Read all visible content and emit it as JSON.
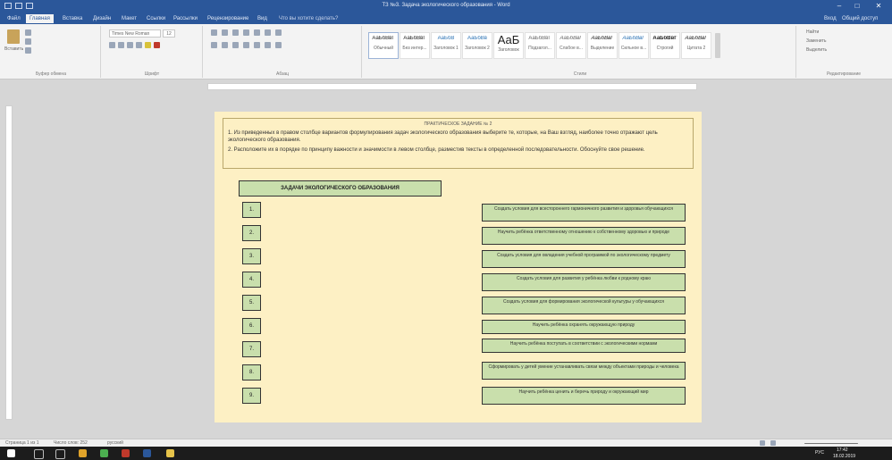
{
  "window": {
    "title": "ТЗ №3. Задача экологического образования - Word",
    "tabs": [
      "Файл",
      "Главная",
      "Вставка",
      "Дизайн",
      "Макет",
      "Ссылки",
      "Рассылки",
      "Рецензирование",
      "Вид"
    ],
    "search_placeholder": "Что вы хотите сделать?",
    "user": "Вход",
    "share": "Общий доступ"
  },
  "ribbon": {
    "groups": [
      "Буфер обмена",
      "Шрифт",
      "Абзац",
      "Стили",
      "Редактирование"
    ],
    "font_name": "Times New Roman",
    "font_size": "12",
    "paste_label": "Вставить",
    "styles": [
      {
        "sample": "АаБбВвГ",
        "name": "Обычный"
      },
      {
        "sample": "АаБбВвГ",
        "name": "Без интер..."
      },
      {
        "sample": "АаБбВ",
        "name": "Заголовок 1"
      },
      {
        "sample": "АаБбВв",
        "name": "Заголовок 2"
      },
      {
        "sample": "АаБ",
        "name": "Заголовок"
      },
      {
        "sample": "АаБбВвГ",
        "name": "Подзагол..."
      },
      {
        "sample": "АаБбВвГ",
        "name": "Слабое в..."
      },
      {
        "sample": "АаБбВвГ",
        "name": "Выделение"
      },
      {
        "sample": "АаБбВвГ",
        "name": "Сильное в..."
      },
      {
        "sample": "АаБбВвГ",
        "name": "Строгий"
      },
      {
        "sample": "АаБбВвГ",
        "name": "Цитата 2"
      }
    ],
    "edit": [
      "Найти",
      "Заменить",
      "Выделить"
    ]
  },
  "document": {
    "task_heading": "ПРАКТИЧЕСКОЕ ЗАДАНИЕ № 2",
    "task_line1": "1. Из приведенных в правом столбце вариантов формулирования задач экологического образования выберите те, которые, на Ваш взгляд, наиболее точно отражают цель экологического образования.",
    "task_line2": "2. Расположите их в порядке по принципу важности и значимости в левом столбце, разместив тексты в определенной последовательности. Обоснуйте свое решение.",
    "left_header": "ЗАДАЧИ ЭКОЛОГИЧЕСКОГО ОБРАЗОВАНИЯ",
    "numbers": [
      "1.",
      "2.",
      "3.",
      "4.",
      "5.",
      "6.",
      "7.",
      "8.",
      "9."
    ],
    "answers": [
      "Создать условия для всестороннего гармоничного развития и здоровья обучающихся",
      "Научить ребёнка ответственному отношению к собственному здоровью и природе",
      "Создать условия для овладения учебной программой по экологическому предмету",
      "Создать условия для развития у ребёнка любви к родному краю",
      "Создать условия для формирования экологической культуры у обучающихся",
      "Научить ребёнка охранять окружающую природу",
      "Научить ребёнка поступать в соответствии с экологическими нормами",
      "Сформировать у детей умение устанавливать связи между объектами природы и человека",
      "Научить ребёнка ценить и беречь природу и окружающий мир"
    ]
  },
  "status": {
    "page": "Страница 1 из 1",
    "words": "Число слов: 252",
    "lang": "русский"
  },
  "taskbar": {
    "time": "17:42",
    "date": "18.02.2019",
    "lang": "РУС"
  }
}
